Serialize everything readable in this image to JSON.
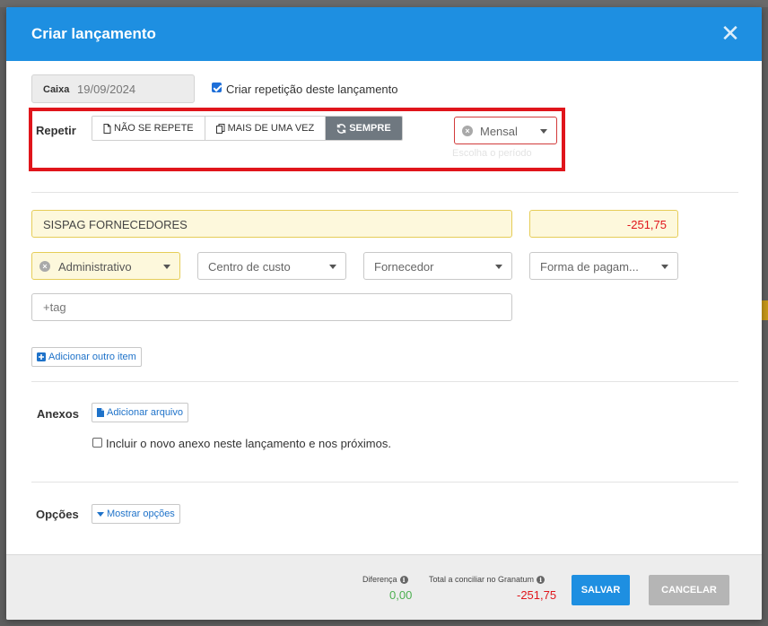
{
  "modal": {
    "title": "Criar lançamento",
    "close_icon": "close-icon"
  },
  "header_row": {
    "caixa_label": "Caixa",
    "caixa_date": "19/09/2024",
    "repeat_checkbox_label": "Criar repetição deste lançamento",
    "repeat_checked": true
  },
  "repeat": {
    "label": "Repetir",
    "options": [
      {
        "label": "NÃO SE REPETE",
        "icon": "document-icon",
        "active": false
      },
      {
        "label": "MAIS DE UMA VEZ",
        "icon": "copy-icon",
        "active": false
      },
      {
        "label": "SEMPRE",
        "icon": "refresh-icon",
        "active": true
      }
    ],
    "period_value": "Mensal",
    "period_hint": "Escolha o período"
  },
  "item": {
    "description": "SISPAG FORNECEDORES",
    "amount": "-251,75",
    "category": "Administrativo",
    "cost_center_placeholder": "Centro de custo",
    "supplier_placeholder": "Fornecedor",
    "payment_placeholder": "Forma de pagam...",
    "tag_placeholder": "+tag",
    "add_item_label": "Adicionar outro item"
  },
  "attachments": {
    "label": "Anexos",
    "add_file_label": "Adicionar arquivo",
    "include_label": "Incluir o novo anexo neste lançamento e nos próximos."
  },
  "options": {
    "label": "Opções",
    "show_label": "Mostrar opções"
  },
  "footer": {
    "difference_label": "Diferença",
    "difference_value": "0,00",
    "total_label": "Total a conciliar no Granatum",
    "total_value": "-251,75",
    "save_label": "SALVAR",
    "cancel_label": "CANCELAR"
  },
  "colors": {
    "accent": "#1e8fe1",
    "negative": "#e0151b",
    "positive": "#4caf50",
    "highlight": "#e0151b"
  }
}
